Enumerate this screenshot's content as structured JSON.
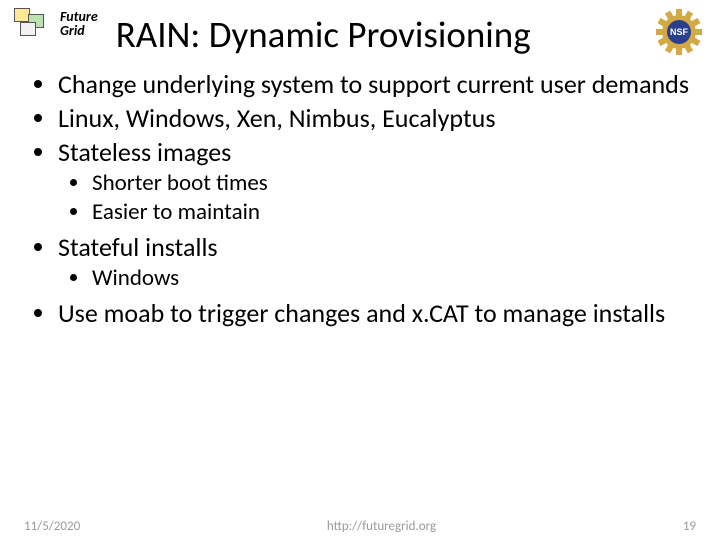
{
  "brand": {
    "line1": "Future",
    "line2": "Grid"
  },
  "title": "RAIN: Dynamic Provisioning",
  "nsf_label": "NSF",
  "bullets": [
    {
      "text": "Change underlying system to support current user demands"
    },
    {
      "text": "Linux, Windows, Xen, Nimbus, Eucalyptus"
    },
    {
      "text": "Stateless images",
      "sub": [
        {
          "text": "Shorter boot times"
        },
        {
          "text": "Easier to maintain"
        }
      ]
    },
    {
      "text": "Stateful installs",
      "sub": [
        {
          "text": "Windows"
        }
      ]
    },
    {
      "text": "Use moab to trigger changes and x.CAT to manage installs"
    }
  ],
  "footer": {
    "date": "11/5/2020",
    "url": "http://futuregrid.org",
    "page": "19"
  }
}
